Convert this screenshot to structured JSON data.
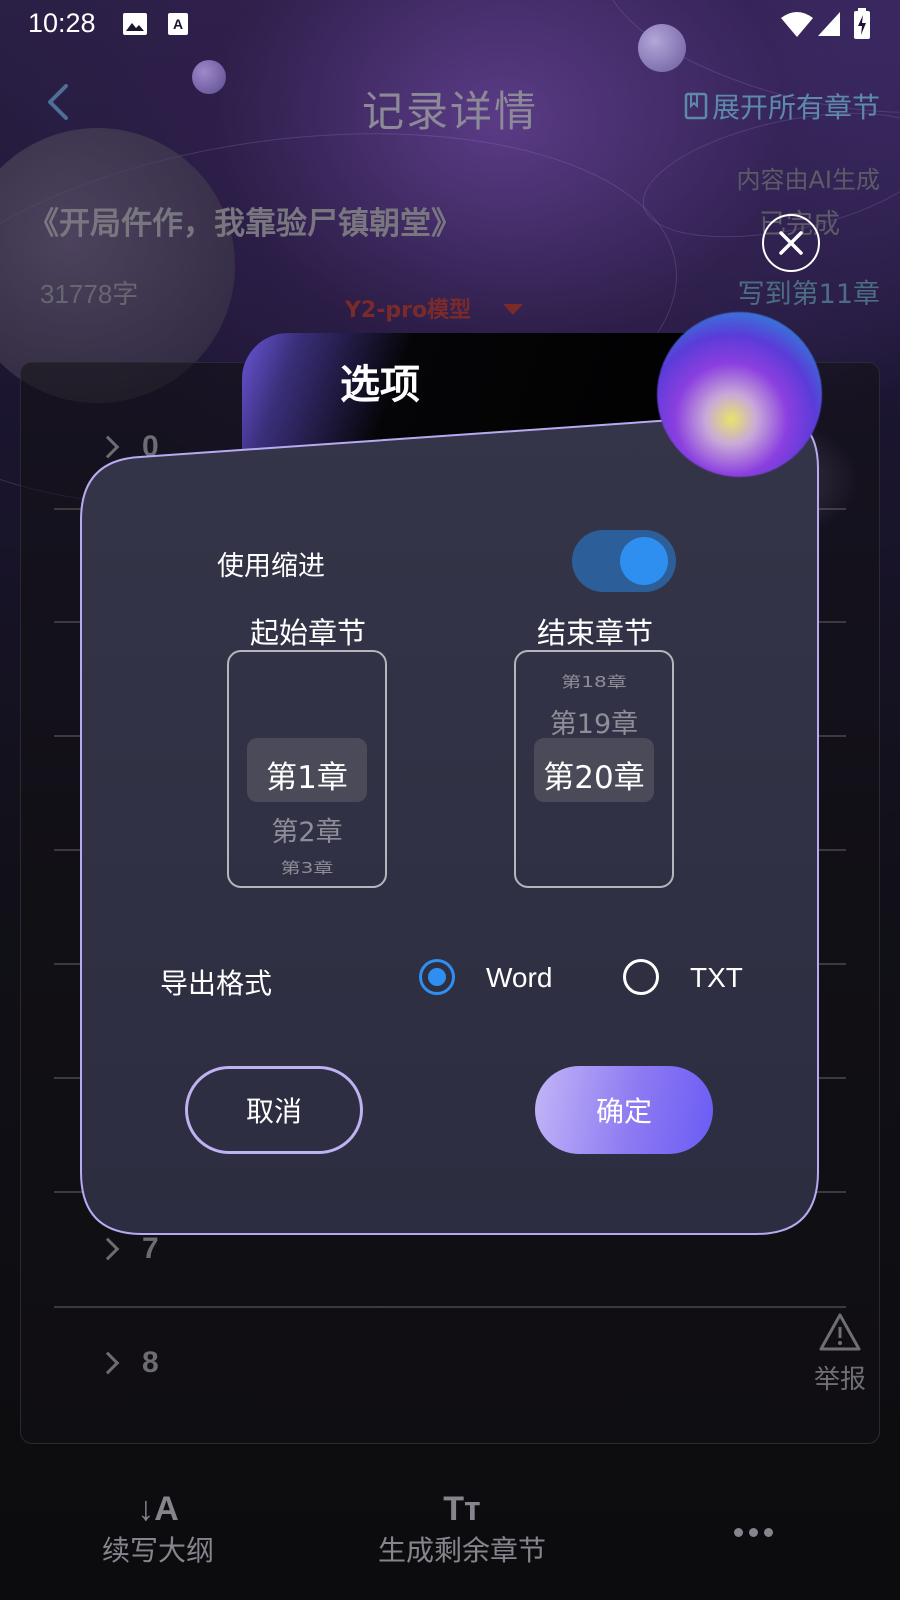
{
  "status": {
    "time": "10:28"
  },
  "header": {
    "title": "记录详情",
    "expand_label": "展开所有章节"
  },
  "book": {
    "title": "《开局仵作，我靠验尸镇朝堂》",
    "word_count": "31778字",
    "ai_note": "内容由AI生成",
    "status": "已完成",
    "written_to": "写到第11章",
    "model": "Y2-pro模型"
  },
  "chapters": {
    "rows": [
      "0",
      "7",
      "8"
    ]
  },
  "report_label": "举报",
  "dialog": {
    "title": "选项",
    "indent_label": "使用缩进",
    "indent_on": true,
    "start_label": "起始章节",
    "end_label": "结束章节",
    "start_picker": {
      "items": [
        "第1章",
        "第2章",
        "第3章"
      ],
      "selected": "第1章"
    },
    "end_picker": {
      "items": [
        "第18章",
        "第19章",
        "第20章"
      ],
      "selected": "第20章"
    },
    "format_label": "导出格式",
    "format_word": "Word",
    "format_txt": "TXT",
    "format_selected": "Word",
    "cancel_label": "取消",
    "confirm_label": "确定"
  },
  "bottom_bar": {
    "outline_label": "续写大纲",
    "outline_icon": "↓A",
    "remaining_label": "生成剩余章节",
    "remaining_icon": "Tт"
  },
  "colors": {
    "accent_blue": "#2f8ff0",
    "button_purple": "#8d7af2",
    "muted_blue": "#5d8aa8"
  }
}
